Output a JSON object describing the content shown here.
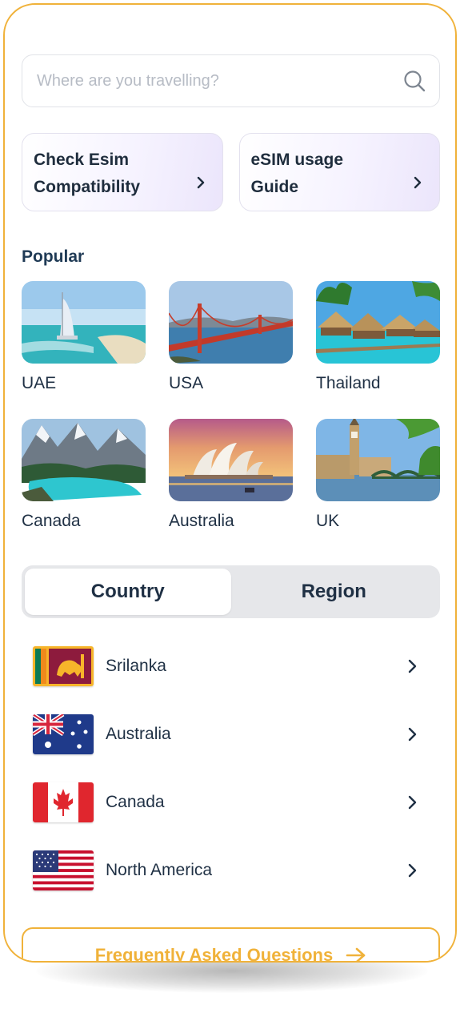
{
  "search": {
    "placeholder": "Where are you travelling?",
    "icon": "search-icon"
  },
  "cards": [
    {
      "label": "Check Esim Compatibility"
    },
    {
      "label": "eSIM usage Guide"
    }
  ],
  "popular": {
    "title": "Popular",
    "destinations": [
      {
        "name": "UAE"
      },
      {
        "name": "USA"
      },
      {
        "name": "Thailand"
      },
      {
        "name": "Canada"
      },
      {
        "name": "Australia"
      },
      {
        "name": "UK"
      }
    ]
  },
  "segment": {
    "tabs": [
      "Country",
      "Region"
    ],
    "selected": "Country"
  },
  "countries": [
    {
      "name": "Srilanka"
    },
    {
      "name": "Australia"
    },
    {
      "name": "Canada"
    },
    {
      "name": "North America"
    }
  ],
  "faq": {
    "label": "Frequently Asked Questions"
  },
  "colors": {
    "accent": "#f0b23a",
    "text": "#1f3044",
    "segment_bg": "#e6e7ea"
  }
}
